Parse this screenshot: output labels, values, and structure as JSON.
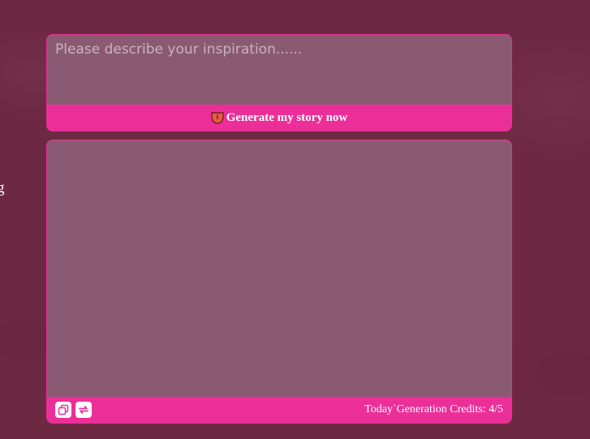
{
  "page": {
    "left_fragment": "g"
  },
  "prompt": {
    "placeholder": "Please describe your inspiration......",
    "value": ""
  },
  "generate": {
    "icon": "tongue-emoji-icon",
    "label": "Generate my story now"
  },
  "output": {
    "text": "",
    "copy_icon": "copy-icon",
    "regenerate_icon": "refresh-icon",
    "credits_label": "Today`Generation Credits: 4/5"
  },
  "colors": {
    "background": "#6e2942",
    "panel": "#8a5a73",
    "accent": "#ec2f98",
    "border": "#e6329a",
    "text": "#ffffff"
  }
}
